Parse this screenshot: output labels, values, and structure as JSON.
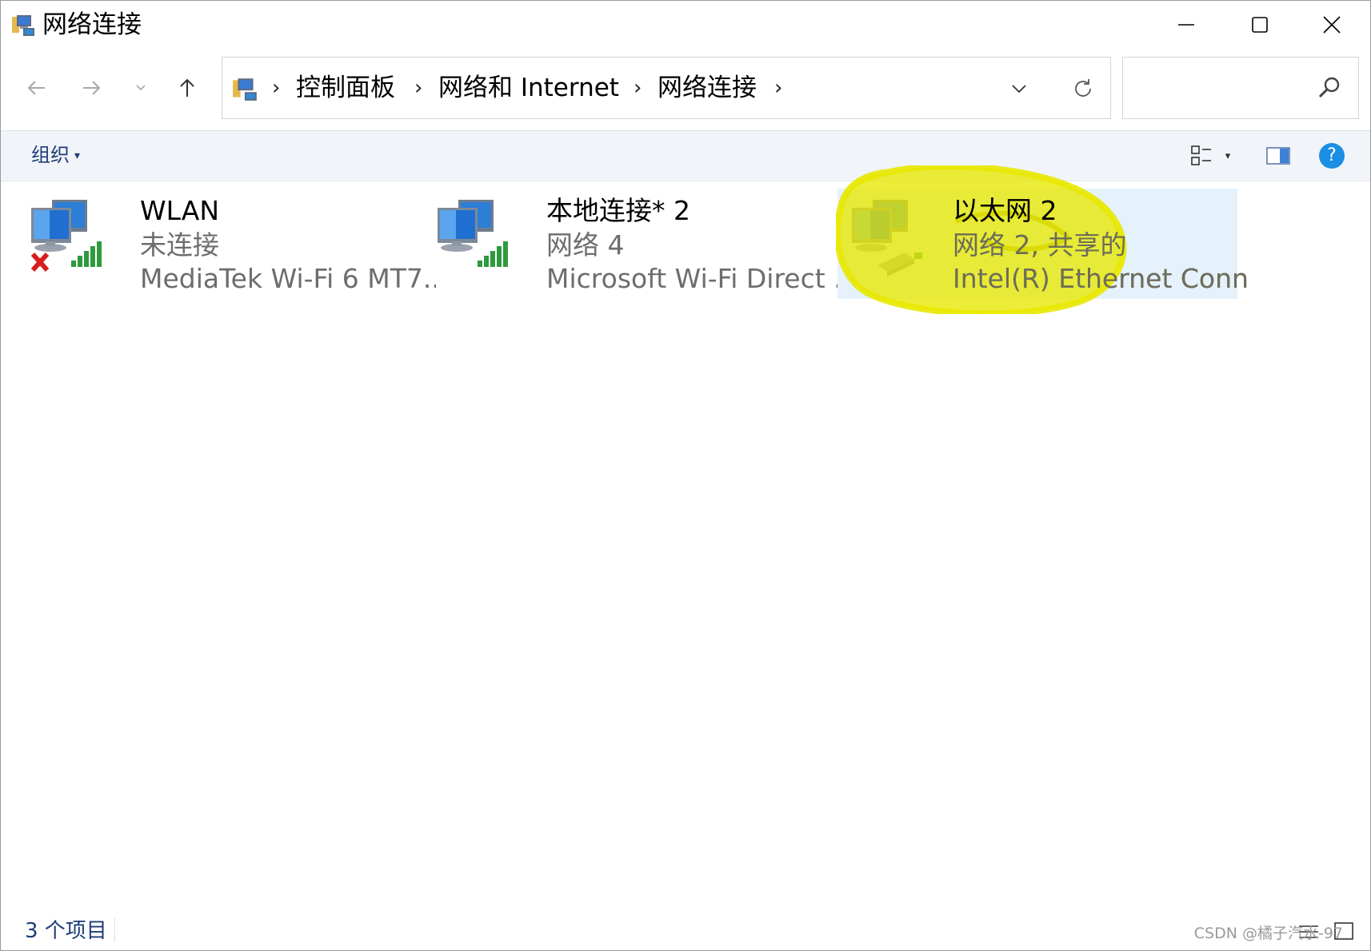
{
  "window": {
    "title": "网络连接",
    "minimize_icon": "minimize-icon",
    "maximize_icon": "maximize-icon",
    "close_icon": "close-icon"
  },
  "nav": {
    "back_icon": "arrow-left-icon",
    "forward_icon": "arrow-right-icon",
    "recent_icon": "chevron-down-icon",
    "up_icon": "arrow-up-icon"
  },
  "address": {
    "crumbs": [
      "控制面板",
      "网络和 Internet",
      "网络连接"
    ],
    "separator": "›"
  },
  "search": {
    "placeholder": "",
    "icon": "search-icon"
  },
  "toolbar": {
    "organize_label": "组织",
    "caret": "▾",
    "view_icon": "view-options-icon",
    "preview_icon": "preview-pane-icon",
    "help_icon": "help-icon",
    "help_label": "?"
  },
  "connections": [
    {
      "name": "WLAN",
      "status": "未连接",
      "device": "MediaTek Wi-Fi 6 MT7...",
      "icon": "wifi-adapter-disconnected-icon",
      "selected": false
    },
    {
      "name": "本地连接* 2",
      "status": "网络 4",
      "device": "Microsoft Wi-Fi Direct ...",
      "icon": "wifi-direct-adapter-icon",
      "selected": false
    },
    {
      "name": "以太网 2",
      "status": "网络 2, 共享的",
      "device": "Intel(R) Ethernet Conn...",
      "icon": "ethernet-adapter-icon",
      "selected": true
    }
  ],
  "status": {
    "item_count": "3 个项目",
    "watermark": "CSDN @橘子汽水-97"
  },
  "colors": {
    "highlight": "#e8e800",
    "selection": "#e5f1fb",
    "link_blue": "#1e3c78",
    "help_blue": "#1a8fe3"
  }
}
